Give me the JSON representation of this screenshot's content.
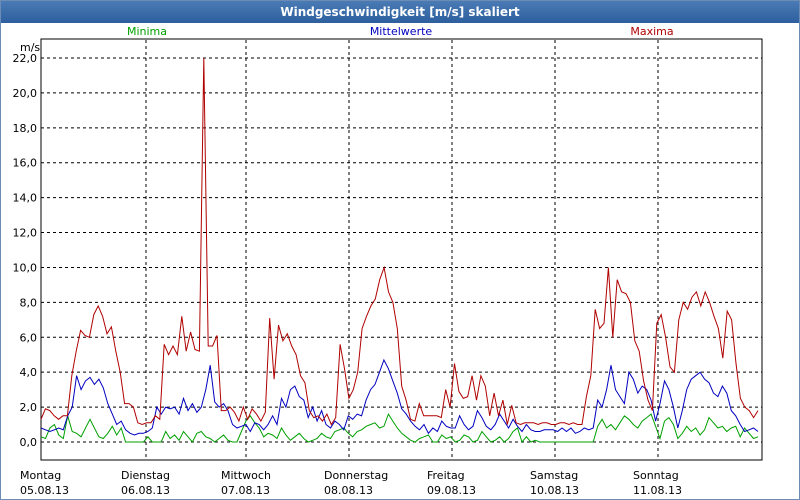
{
  "window": {
    "title": "Windgeschwindigkeit [m/s] skaliert"
  },
  "chart_data": {
    "type": "line",
    "title": "Windgeschwindigkeit [m/s] skaliert",
    "ylabel": "m/s",
    "ylim": [
      0,
      22
    ],
    "yticks": [
      "0,0",
      "2,0",
      "4,0",
      "6,0",
      "8,0",
      "10,0",
      "12,0",
      "14,0",
      "16,0",
      "18,0",
      "20,0",
      "22,0"
    ],
    "grid": true,
    "legend": "top",
    "day_labels": [
      {
        "day": "Montag",
        "date": "05.08.13"
      },
      {
        "day": "Dienstag",
        "date": "06.08.13"
      },
      {
        "day": "Mittwoch",
        "date": "07.08.13"
      },
      {
        "day": "Donnerstag",
        "date": "08.08.13"
      },
      {
        "day": "Freitag",
        "date": "09.08.13"
      },
      {
        "day": "Samstag",
        "date": "10.08.13"
      },
      {
        "day": "Sonntag",
        "date": "11.08.13"
      }
    ],
    "series": [
      {
        "name": "Minima",
        "color": "#00a000",
        "values": [
          0.3,
          0.2,
          0.8,
          1.0,
          0.4,
          0.2,
          1.5,
          0.6,
          0.5,
          0.3,
          0.8,
          1.3,
          0.8,
          0.3,
          0.2,
          0.5,
          0.9,
          0.4,
          0.8,
          0.0,
          0.0,
          0.0,
          0.0,
          0.0,
          0.3,
          0.0,
          0.0,
          0.0,
          0.6,
          0.2,
          0.4,
          0.1,
          0.6,
          0.3,
          0.0,
          0.5,
          0.6,
          0.3,
          0.2,
          0.0,
          0.2,
          0.4,
          0.1,
          0.0,
          0.0,
          0.6,
          1.2,
          1.5,
          1.1,
          0.8,
          0.3,
          0.5,
          0.4,
          0.2,
          0.8,
          0.4,
          0.1,
          0.3,
          0.5,
          0.2,
          0.0,
          0.1,
          0.2,
          0.5,
          0.3,
          0.2,
          0.6,
          0.7,
          0.8,
          0.5,
          0.3,
          0.6,
          0.7,
          0.9,
          1.0,
          1.1,
          0.8,
          0.9,
          1.6,
          1.2,
          0.8,
          0.5,
          0.3,
          0.1,
          0.0,
          0.2,
          0.3,
          0.4,
          0.0,
          0.0,
          0.4,
          0.2,
          0.3,
          0.0,
          0.1,
          0.4,
          0.3,
          0.0,
          0.1,
          0.6,
          0.3,
          0.0,
          0.1,
          0.3,
          0.0,
          0.2,
          0.6,
          0.8,
          0.0,
          0.3,
          0.0,
          0.1,
          0.0,
          0.0,
          0.0,
          0.0,
          0.0,
          0.0,
          0.0,
          0.0,
          0.0,
          0.0,
          0.0,
          0.0,
          0.0,
          0.9,
          1.3,
          0.8,
          1.0,
          0.7,
          1.1,
          1.5,
          1.3,
          1.0,
          0.8,
          1.2,
          1.4,
          1.6,
          0.9,
          0.2,
          1.2,
          1.4,
          1.0,
          0.2,
          0.5,
          0.9,
          0.6,
          0.8,
          0.4,
          0.7,
          1.4,
          1.1,
          0.8,
          0.9,
          0.6,
          0.8,
          0.9,
          0.3,
          0.8,
          0.5,
          0.2,
          0.3
        ]
      },
      {
        "name": "Mittelwerte",
        "color": "#0000c0",
        "values": [
          0.8,
          0.7,
          0.6,
          0.7,
          0.8,
          0.7,
          1.5,
          2.0,
          3.8,
          3.0,
          3.5,
          3.7,
          3.3,
          3.6,
          3.1,
          2.2,
          1.6,
          1.0,
          1.2,
          0.7,
          0.5,
          0.4,
          0.5,
          0.5,
          0.6,
          0.8,
          2.0,
          1.6,
          2.0,
          1.9,
          2.0,
          1.6,
          2.5,
          1.8,
          2.2,
          1.7,
          2.0,
          3.0,
          4.4,
          2.3,
          2.0,
          2.2,
          1.8,
          1.0,
          0.8,
          0.9,
          1.0,
          0.6,
          1.1,
          1.0,
          0.7,
          1.0,
          1.5,
          1.0,
          2.5,
          2.0,
          3.0,
          3.2,
          2.6,
          2.4,
          1.4,
          2.0,
          1.2,
          1.8,
          1.0,
          0.8,
          1.2,
          1.0,
          0.7,
          1.5,
          1.3,
          1.6,
          1.5,
          2.4,
          3.0,
          3.3,
          4.0,
          4.7,
          4.2,
          3.5,
          2.8,
          1.9,
          1.6,
          1.2,
          0.9,
          0.7,
          1.0,
          0.5,
          0.8,
          0.6,
          1.2,
          0.9,
          0.8,
          0.8,
          1.5,
          1.0,
          0.7,
          0.9,
          1.8,
          1.4,
          0.9,
          0.7,
          1.0,
          1.6,
          1.2,
          0.8,
          1.3,
          0.9,
          0.6,
          1.0,
          0.7,
          0.6,
          0.6,
          0.7,
          0.7,
          0.7,
          0.6,
          0.8,
          0.6,
          0.8,
          0.5,
          0.6,
          0.8,
          0.7,
          0.8,
          2.4,
          2.0,
          3.0,
          4.4,
          3.0,
          2.6,
          2.2,
          4.0,
          3.6,
          2.8,
          3.2,
          3.0,
          2.4,
          1.2,
          2.2,
          3.5,
          3.0,
          2.0,
          0.8,
          1.8,
          3.0,
          3.6,
          3.8,
          4.0,
          3.6,
          3.4,
          2.8,
          2.6,
          3.2,
          2.8,
          1.8,
          1.5,
          1.0,
          0.6,
          0.7,
          0.8,
          0.6
        ]
      },
      {
        "name": "Maxima",
        "color": "#b00000",
        "values": [
          1.3,
          1.9,
          1.8,
          1.5,
          1.3,
          1.5,
          1.5,
          3.8,
          5.2,
          6.4,
          6.1,
          6.0,
          7.3,
          7.8,
          7.2,
          6.2,
          6.6,
          5.2,
          4.0,
          2.2,
          2.2,
          2.0,
          1.1,
          1.0,
          1.1,
          1.1,
          1.5,
          1.3,
          5.6,
          5.0,
          5.5,
          5.0,
          7.2,
          5.2,
          6.3,
          5.3,
          5.2,
          22.0,
          5.5,
          5.5,
          6.1,
          1.8,
          1.8,
          2.0,
          1.7,
          1.2,
          2.0,
          1.3,
          1.9,
          1.6,
          1.2,
          1.7,
          7.1,
          3.6,
          6.7,
          5.8,
          6.2,
          5.5,
          5.0,
          3.8,
          3.4,
          1.8,
          1.4,
          1.5,
          1.2,
          1.6,
          1.0,
          1.4,
          5.6,
          4.2,
          2.5,
          3.0,
          4.0,
          6.5,
          7.2,
          7.8,
          8.2,
          9.3,
          10.0,
          8.6,
          8.0,
          6.5,
          3.2,
          2.4,
          1.3,
          1.2,
          2.2,
          1.5,
          1.5,
          1.5,
          1.5,
          1.4,
          3.0,
          2.0,
          4.5,
          2.9,
          2.5,
          2.6,
          3.8,
          2.4,
          3.8,
          3.2,
          1.5,
          2.8,
          1.5,
          2.4,
          1.0,
          2.1,
          1.1,
          1.0,
          1.1,
          1.1,
          1.1,
          1.0,
          1.1,
          1.1,
          1.0,
          1.0,
          1.1,
          1.1,
          1.0,
          1.1,
          1.0,
          1.0,
          2.6,
          3.8,
          7.6,
          6.5,
          6.8,
          10.0,
          6.0,
          9.3,
          8.6,
          8.5,
          8.0,
          5.8,
          5.2,
          3.5,
          2.4,
          1.8,
          6.8,
          7.3,
          6.0,
          4.3,
          4.0,
          7.0,
          8.0,
          7.6,
          8.3,
          8.6,
          7.8,
          8.6,
          8.0,
          7.2,
          6.5,
          4.8,
          7.5,
          7.0,
          4.5,
          2.5,
          2.0,
          1.8,
          1.4,
          1.8
        ]
      }
    ]
  }
}
